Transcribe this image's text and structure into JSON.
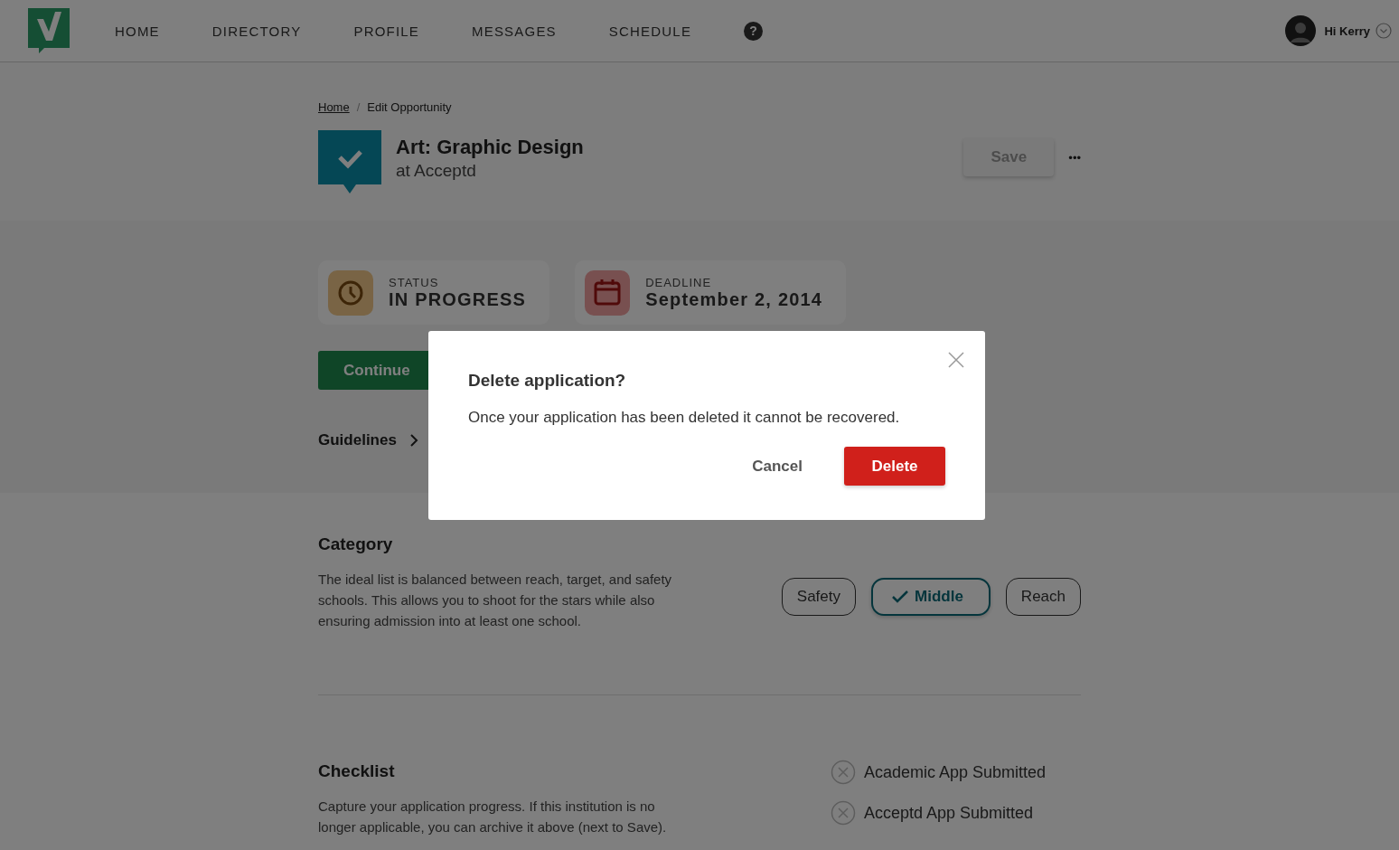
{
  "nav": {
    "items": [
      {
        "label": "HOME"
      },
      {
        "label": "DIRECTORY"
      },
      {
        "label": "PROFILE"
      },
      {
        "label": "MESSAGES"
      },
      {
        "label": "SCHEDULE"
      }
    ],
    "help": "?",
    "greeting": "Hi Kerry"
  },
  "breadcrumb": {
    "separator": "/",
    "items": [
      {
        "label": "Home",
        "kind": "link"
      },
      {
        "label": "Edit Opportunity",
        "kind": "current"
      }
    ]
  },
  "opportunity": {
    "title": "Art: Graphic Design",
    "subtitle": "at Acceptd",
    "save": "Save",
    "more": "•••"
  },
  "stats": [
    {
      "kind": "status",
      "label": "STATUS",
      "value": "IN PROGRESS"
    },
    {
      "kind": "deadline",
      "label": "DEADLINE",
      "value": "September 2, 2014"
    }
  ],
  "continue_button": "Continue",
  "guidelines": "Guidelines",
  "category": {
    "title": "Category",
    "description": "The ideal list is balanced between reach, target, and safety schools. This allows you to shoot for the stars while also ensuring admission into at least one school.",
    "options": [
      {
        "label": "Safety",
        "selected": false
      },
      {
        "label": "Middle",
        "selected": true
      },
      {
        "label": "Reach",
        "selected": false
      }
    ]
  },
  "checklist": {
    "title": "Checklist",
    "description": "Capture your application progress. If this institution is no longer applicable, you can archive it above (next to Save).",
    "items": [
      {
        "label": "Academic App Submitted",
        "checked": false
      },
      {
        "label": "Acceptd App Submitted",
        "checked": false
      }
    ]
  },
  "dialog": {
    "title": "Delete application?",
    "message": "Once your application has been deleted it cannot be recovered.",
    "cancel": "Cancel",
    "confirm": "Delete"
  }
}
